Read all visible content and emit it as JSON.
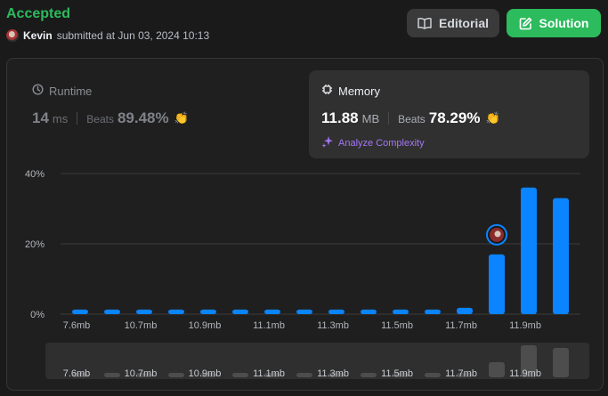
{
  "status": "Accepted",
  "author": {
    "name": "Kevin",
    "meta": "submitted at Jun 03, 2024 10:13"
  },
  "buttons": {
    "editorial": "Editorial",
    "solution": "Solution"
  },
  "runtime": {
    "label": "Runtime",
    "value": "14",
    "unit": "ms",
    "beats_label": "Beats",
    "beats_value": "89.48%"
  },
  "memory": {
    "label": "Memory",
    "value": "11.88",
    "unit": "MB",
    "beats_label": "Beats",
    "beats_value": "78.29%",
    "analyze": "Analyze Complexity"
  },
  "colors": {
    "accepted": "#2cbb5d",
    "bar": "#0a84ff",
    "overview_bar": "#4d4d4d",
    "analyze": "#a476f5"
  },
  "chart_data": {
    "type": "bar",
    "ylabel": "",
    "ylim": [
      0,
      40
    ],
    "yticks": [
      "0%",
      "20%",
      "40%"
    ],
    "ytick_values": [
      0,
      20,
      40
    ],
    "x_tick_labels": [
      "7.6mb",
      "10.7mb",
      "10.9mb",
      "11.1mb",
      "11.3mb",
      "11.5mb",
      "11.7mb",
      "11.9mb"
    ],
    "values": [
      1.3,
      1.3,
      1.3,
      1.3,
      1.3,
      1.3,
      1.3,
      1.3,
      1.3,
      1.3,
      1.3,
      1.3,
      1.8,
      17,
      36,
      33
    ],
    "user_bar_index": 13,
    "overview_values": [
      0.6,
      0.6,
      0.6,
      0.6,
      0.6,
      0.6,
      0.6,
      0.6,
      0.6,
      0.6,
      0.6,
      0.6,
      0.8,
      17,
      36,
      33
    ]
  }
}
